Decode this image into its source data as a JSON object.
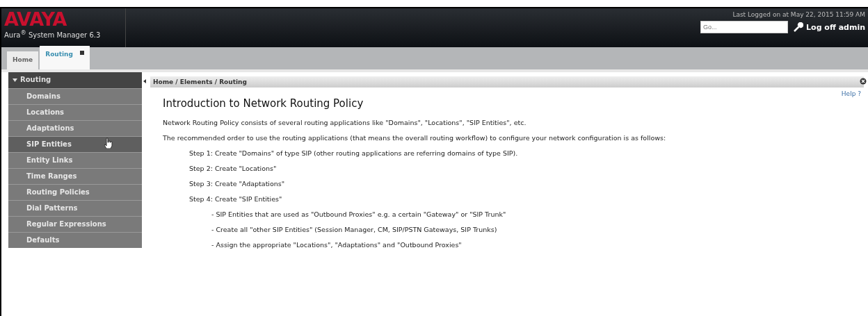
{
  "header": {
    "logo": "AVAYA",
    "product": "Aura",
    "product_mark": "®",
    "product_rest": " System Manager 6.3",
    "last_logged": "Last Logged on at May 22, 2015 11:59 AM",
    "search": {
      "placeholder": "Go..."
    },
    "logoff": "Log off admin"
  },
  "tabs": [
    {
      "label": "Home",
      "selected": false,
      "closable": false
    },
    {
      "label": "Routing",
      "selected": true,
      "closable": true
    }
  ],
  "sidebar": {
    "title": "Routing",
    "expanded": true,
    "items": [
      {
        "label": "Domains",
        "selected": false
      },
      {
        "label": "Locations",
        "selected": false
      },
      {
        "label": "Adaptations",
        "selected": false
      },
      {
        "label": "SIP Entities",
        "selected": true
      },
      {
        "label": "Entity Links",
        "selected": false
      },
      {
        "label": "Time Ranges",
        "selected": false
      },
      {
        "label": "Routing Policies",
        "selected": false
      },
      {
        "label": "Dial Patterns",
        "selected": false
      },
      {
        "label": "Regular Expressions",
        "selected": false
      },
      {
        "label": "Defaults",
        "selected": false
      }
    ]
  },
  "breadcrumb": "Home / Elements / Routing",
  "help": "Help ?",
  "content": {
    "title": "Introduction to Network Routing Policy",
    "paragraphs": [
      {
        "kind": "para",
        "text": "Network Routing Policy consists of several routing applications like \"Domains\", \"Locations\", \"SIP Entities\", etc."
      },
      {
        "kind": "para",
        "text": "The recommended order to use the routing applications (that means the overall routing workflow) to configure your network configuration is as follows:"
      },
      {
        "kind": "step",
        "text": "Step 1: Create \"Domains\" of type SIP (other routing applications are referring domains of type SIP)."
      },
      {
        "kind": "step",
        "text": "Step 2: Create \"Locations\""
      },
      {
        "kind": "step",
        "text": "Step 3: Create \"Adaptations\""
      },
      {
        "kind": "step",
        "text": "Step 4: Create \"SIP Entities\""
      },
      {
        "kind": "sub",
        "text": "- SIP Entities that are used as \"Outbound Proxies\" e.g. a certain \"Gateway\" or \"SIP Trunk\""
      },
      {
        "kind": "sub",
        "text": "- Create all \"other SIP Entities\" (Session Manager, CM, SIP/PSTN Gateways, SIP Trunks)"
      },
      {
        "kind": "sub",
        "text": "- Assign the appropriate \"Locations\", \"Adaptations\" and \"Outbound Proxies\""
      }
    ]
  }
}
